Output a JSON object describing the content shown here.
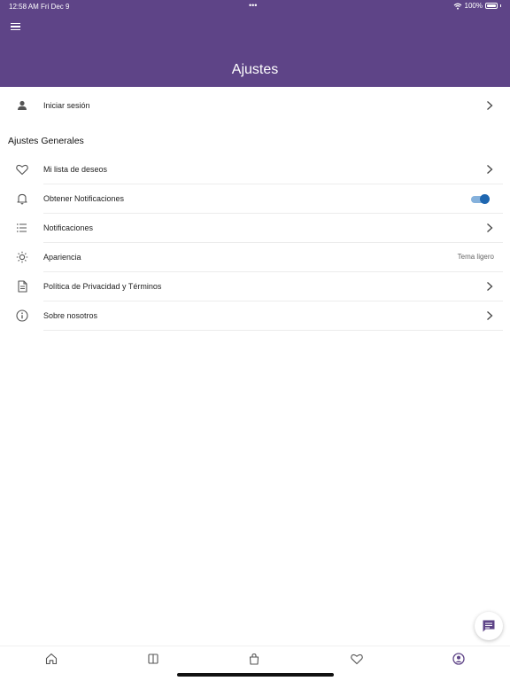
{
  "status_bar": {
    "time": "12:58 AM",
    "date": "Fri Dec 9",
    "dots": "•••",
    "battery": "100%"
  },
  "header": {
    "title": "Ajustes",
    "background_color": "#5e4487",
    "menu_icon": "hamburger-menu-icon"
  },
  "login_row": {
    "label": "Iniciar sesión",
    "icon": "person-icon"
  },
  "section": {
    "title": "Ajustes Generales"
  },
  "settings": [
    {
      "label": "Mi lista de deseos",
      "icon": "heart-icon",
      "trailing": "chevron"
    },
    {
      "label": "Obtener Notificaciones",
      "icon": "bell-icon",
      "trailing": "toggle",
      "toggle_on": true
    },
    {
      "label": "Notificaciones",
      "icon": "list-icon",
      "trailing": "chevron"
    },
    {
      "label": "Apariencia",
      "icon": "sun-icon",
      "trailing": "value",
      "value": "Tema ligero"
    },
    {
      "label": "Política de Privacidad y Términos",
      "icon": "document-icon",
      "trailing": "chevron"
    },
    {
      "label": "Sobre nosotros",
      "icon": "info-icon",
      "trailing": "chevron"
    }
  ],
  "fab": {
    "icon": "chat-message-icon"
  },
  "tabbar": {
    "tabs": [
      {
        "icon": "home-icon"
      },
      {
        "icon": "book-icon"
      },
      {
        "icon": "shopping-bag-icon"
      },
      {
        "icon": "heart-icon"
      },
      {
        "icon": "profile-icon",
        "active": true
      }
    ]
  },
  "colors": {
    "accent": "#5e4487",
    "toggle": "#1e66b0"
  }
}
